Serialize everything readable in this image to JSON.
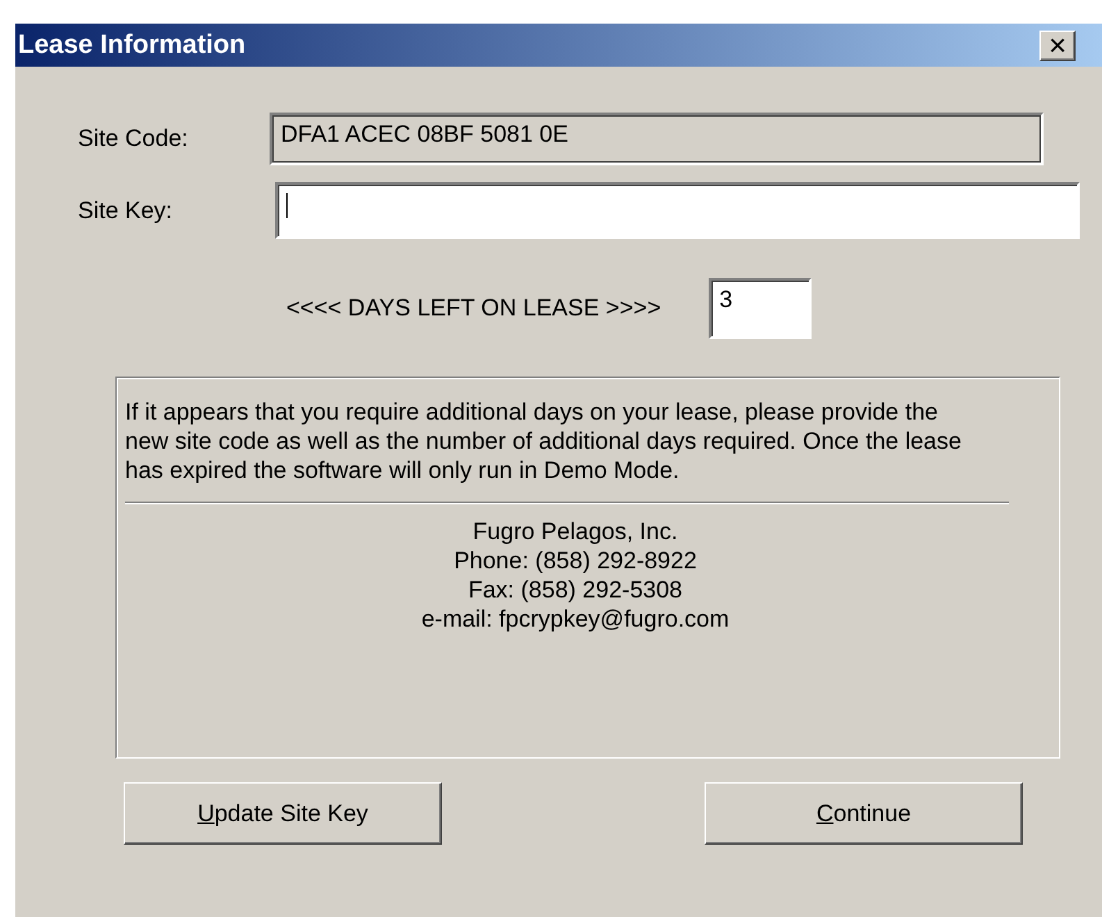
{
  "window": {
    "title": "Lease Information",
    "close_symbol": "×"
  },
  "site_code": {
    "label": "Site Code:",
    "value": "DFA1 ACEC 08BF 5081 0E",
    "readonly": true
  },
  "site_key": {
    "label": "Site Key:",
    "focused": true
  },
  "days_left": {
    "label": "<<<< DAYS LEFT ON LEASE >>>>",
    "value": "3"
  },
  "info": {
    "message": "If it appears that you require additional days on your lease, please provide the new site code as well as the number of additional days required. Once the lease has expired the software will only run in Demo Mode.",
    "contact": [
      "Fugro Pelagos, Inc.",
      "Phone: (858) 292-8922",
      "Fax: (858) 292-5308",
      "e-mail: fpcrypkey@fugro.com"
    ]
  },
  "buttons": [
    {
      "label": "Update Site Key",
      "first_letter_underlined": true
    },
    {
      "label": "Continue",
      "first_letter_underlined": true
    }
  ]
}
